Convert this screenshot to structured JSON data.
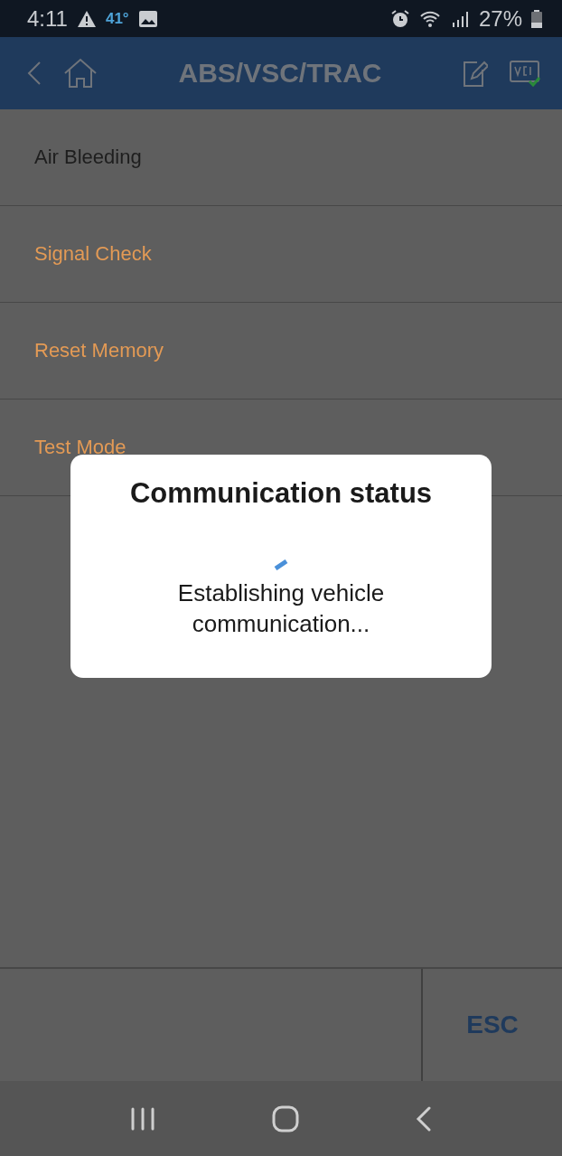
{
  "status_bar": {
    "time": "4:11",
    "temperature": "41°",
    "battery": "27%"
  },
  "header": {
    "title": "ABS/VSC/TRAC"
  },
  "menu_items": [
    {
      "label": "Air Bleeding",
      "color": "#1e1e1e"
    },
    {
      "label": "Signal Check",
      "color": "#e39a55"
    },
    {
      "label": "Reset Memory",
      "color": "#e39a55"
    },
    {
      "label": "Test Mode",
      "color": "#e39a55"
    }
  ],
  "dialog": {
    "title": "Communication status",
    "message": "Establishing vehicle communication..."
  },
  "footer": {
    "esc_button": "ESC"
  }
}
